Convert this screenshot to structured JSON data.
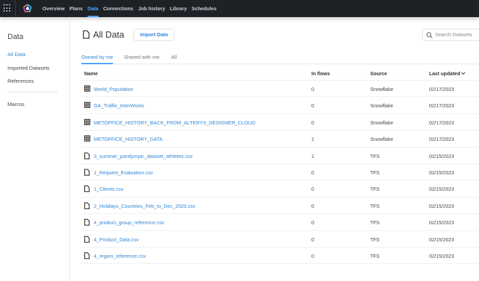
{
  "nav": {
    "items": [
      "Overview",
      "Plans",
      "Data",
      "Connections",
      "Job history",
      "Library",
      "Schedules"
    ],
    "active": "Data"
  },
  "sidebar": {
    "title": "Data",
    "items": [
      "All Data",
      "Imported Datasets",
      "References"
    ],
    "extra": "Macros",
    "active": "All Data"
  },
  "header": {
    "title": "All Data",
    "import_label": "Import Data",
    "search_placeholder": "Search Datasets"
  },
  "tabs": [
    "Owned by me",
    "Shared with me",
    "All"
  ],
  "table": {
    "columns": [
      "Name",
      "In flows",
      "Source",
      "Last updated"
    ],
    "sort_icon": "chevron-down-icon",
    "rows": [
      {
        "icon": "table-icon",
        "name": "World_Population",
        "in_flows": "0",
        "source": "Snowflake",
        "updated": "02/17/2023"
      },
      {
        "icon": "table-icon",
        "name": "GA_Traffic_InterWorks",
        "in_flows": "0",
        "source": "Snowflake",
        "updated": "02/17/2023"
      },
      {
        "icon": "table-icon",
        "name": "METOFFICE_HISTORY_BACK_FROM_ALTERYX_DESIGNER_CLOUD",
        "in_flows": "0",
        "source": "Snowflake",
        "updated": "02/17/2023"
      },
      {
        "icon": "table-icon",
        "name": "METOFFICE_HISTORY_DATA",
        "in_flows": "1",
        "source": "Snowflake",
        "updated": "02/17/2023"
      },
      {
        "icon": "file-icon",
        "name": "3_summer_paralympic_dataset_athletes.csv",
        "in_flows": "1",
        "source": "TFS",
        "updated": "02/15/2023"
      },
      {
        "icon": "file-icon",
        "name": "1_Request_Evaluation.csv",
        "in_flows": "0",
        "source": "TFS",
        "updated": "02/15/2023"
      },
      {
        "icon": "file-icon",
        "name": "1_Clients.csv",
        "in_flows": "0",
        "source": "TFS",
        "updated": "02/15/2023"
      },
      {
        "icon": "file-icon",
        "name": "2_Holidays_Countries_Feb_to_Dec_2020.csv",
        "in_flows": "0",
        "source": "TFS",
        "updated": "02/15/2023"
      },
      {
        "icon": "file-icon",
        "name": "4_product_group_reference.csv",
        "in_flows": "0",
        "source": "TFS",
        "updated": "02/15/2023"
      },
      {
        "icon": "file-icon",
        "name": "4_Product_Data.csv",
        "in_flows": "0",
        "source": "TFS",
        "updated": "02/15/2023"
      },
      {
        "icon": "file-icon",
        "name": "4_region_reference.csv",
        "in_flows": "0",
        "source": "TFS",
        "updated": "02/15/2023"
      }
    ]
  }
}
